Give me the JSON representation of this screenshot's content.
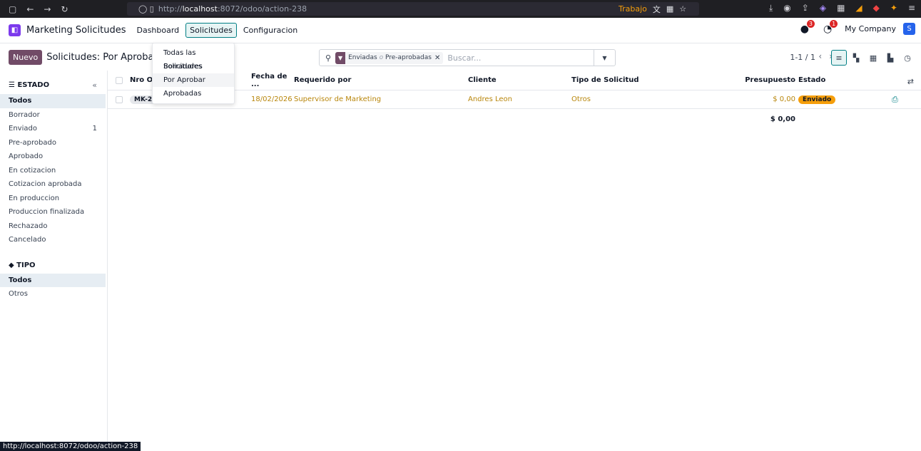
{
  "browser": {
    "url_prefix": "http://",
    "url_host": "localhost",
    "url_rest": ":8072/odoo/action-238",
    "container_label": "Trabajo",
    "status_url": "http://localhost:8072/odoo/action-238"
  },
  "navbar": {
    "app_name": "Marketing Solicitudes",
    "menus": [
      "Dashboard",
      "Solicitudes",
      "Configuracion"
    ],
    "chat_badge": "3",
    "activity_badge": "1",
    "company": "My Company",
    "user_initial": "S"
  },
  "control": {
    "new_label": "Nuevo",
    "breadcrumb": "Solicitudes: Por Aprobar",
    "facet_a": "Enviadas",
    "facet_or": "o",
    "facet_b": "Pre-aprobadas",
    "search_placeholder": "Buscar...",
    "pager": "1-1 / 1"
  },
  "dropdown": {
    "items": [
      "Todas las Solicitudes",
      "Borradores",
      "Por Aprobar",
      "Aprobadas"
    ]
  },
  "sidebar": {
    "estado_title": "ESTADO",
    "estado_items": [
      {
        "label": "Todos",
        "count": ""
      },
      {
        "label": "Borrador",
        "count": ""
      },
      {
        "label": "Enviado",
        "count": "1"
      },
      {
        "label": "Pre-aprobado",
        "count": ""
      },
      {
        "label": "Aprobado",
        "count": ""
      },
      {
        "label": "En cotizacion",
        "count": ""
      },
      {
        "label": "Cotizacion aprobada",
        "count": ""
      },
      {
        "label": "En produccion",
        "count": ""
      },
      {
        "label": "Produccion finalizada",
        "count": ""
      },
      {
        "label": "Rechazado",
        "count": ""
      },
      {
        "label": "Cancelado",
        "count": ""
      }
    ],
    "tipo_title": "TIPO",
    "tipo_items": [
      "Todos",
      "Otros"
    ]
  },
  "list": {
    "headers": {
      "nro": "Nro Orden",
      "fecha": "Fecha de ...",
      "requerido": "Requerido por",
      "cliente": "Cliente",
      "tipo": "Tipo de Solicitud",
      "presupuesto": "Presupuesto",
      "estado": "Estado"
    },
    "rows": [
      {
        "nro": "MK-2026-0001",
        "fecha": "18/02/2026",
        "requerido": "Supervisor de Marketing",
        "cliente": "Andres Leon",
        "tipo": "Otros",
        "presupuesto": "$ 0,00",
        "estado": "Enviado"
      }
    ],
    "total": "$ 0,00"
  }
}
